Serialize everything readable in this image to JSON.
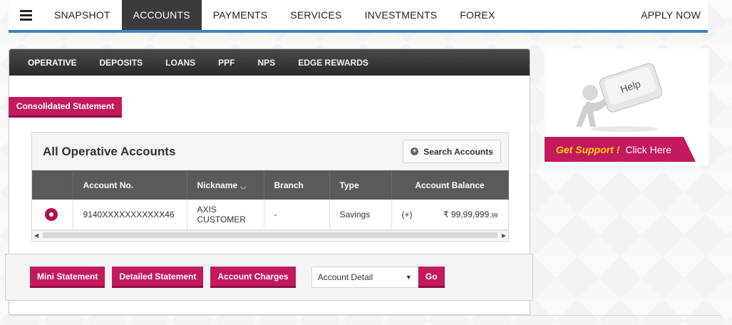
{
  "topnav": {
    "items": [
      "SNAPSHOT",
      "ACCOUNTS",
      "PAYMENTS",
      "SERVICES",
      "INVESTMENTS",
      "FOREX"
    ],
    "active": "ACCOUNTS",
    "apply_now": "APPLY NOW"
  },
  "subtabs": {
    "items": [
      "OPERATIVE",
      "DEPOSITS",
      "LOANS",
      "PPF",
      "NPS",
      "EDGE REWARDS"
    ],
    "active": "OPERATIVE"
  },
  "consolidated_statement": "Consolidated Statement",
  "accounts": {
    "title": "All Operative Accounts",
    "search_button": "Search Accounts",
    "columns": [
      "Account No.",
      "Nickname",
      "Branch",
      "Type",
      "Account Balance"
    ],
    "rows": [
      {
        "account_no": "9140XXXXXXXXXXX46",
        "nickname": "AXIS CUSTOMER",
        "branch": "-",
        "type": "Savings",
        "sign": "(+)",
        "balance_main": "₹ 99,99,999.",
        "balance_decimal": "99"
      }
    ]
  },
  "actions": {
    "mini_statement": "Mini Statement",
    "detailed_statement": "Detailed Statement",
    "account_charges": "Account Charges",
    "select_value": "Account Detail",
    "go": "Go"
  },
  "help": {
    "key_text": "Help",
    "get_support": "Get Support !",
    "click_here": "Click Here"
  },
  "colors": {
    "accent": "#c3195d",
    "nav_active": "#3b3b3b",
    "nav_underline": "#3f82c5",
    "support_yellow": "#ffd200"
  }
}
